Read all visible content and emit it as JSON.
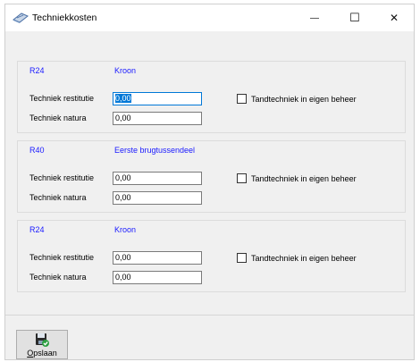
{
  "window": {
    "title": "Techniekkosten",
    "minimize_glyph": "—",
    "maximize_glyph": "☐",
    "close_glyph": "✕"
  },
  "groups": [
    {
      "code": "R24",
      "description": "Kroon",
      "restitutie_label": "Techniek restitutie",
      "restitutie_value": "0,00",
      "natura_label": "Techniek natura",
      "natura_value": "0,00",
      "checkbox_label": "Tandtechniek in eigen beheer",
      "checked": false
    },
    {
      "code": "R40",
      "description": "Eerste brugtussendeel",
      "restitutie_label": "Techniek restitutie",
      "restitutie_value": "0,00",
      "natura_label": "Techniek natura",
      "natura_value": "0,00",
      "checkbox_label": "Tandtechniek in eigen beheer",
      "checked": false
    },
    {
      "code": "R24",
      "description": "Kroon",
      "restitutie_label": "Techniek restitutie",
      "restitutie_value": "0,00",
      "natura_label": "Techniek natura",
      "natura_value": "0,00",
      "checkbox_label": "Tandtechniek in eigen beheer",
      "checked": false
    }
  ],
  "footer": {
    "save_label_first": "O",
    "save_label_rest": "pslaan",
    "save_icon": "save-disk-icon"
  },
  "colors": {
    "accent": "#1a1aff",
    "selection": "#0078d7"
  }
}
